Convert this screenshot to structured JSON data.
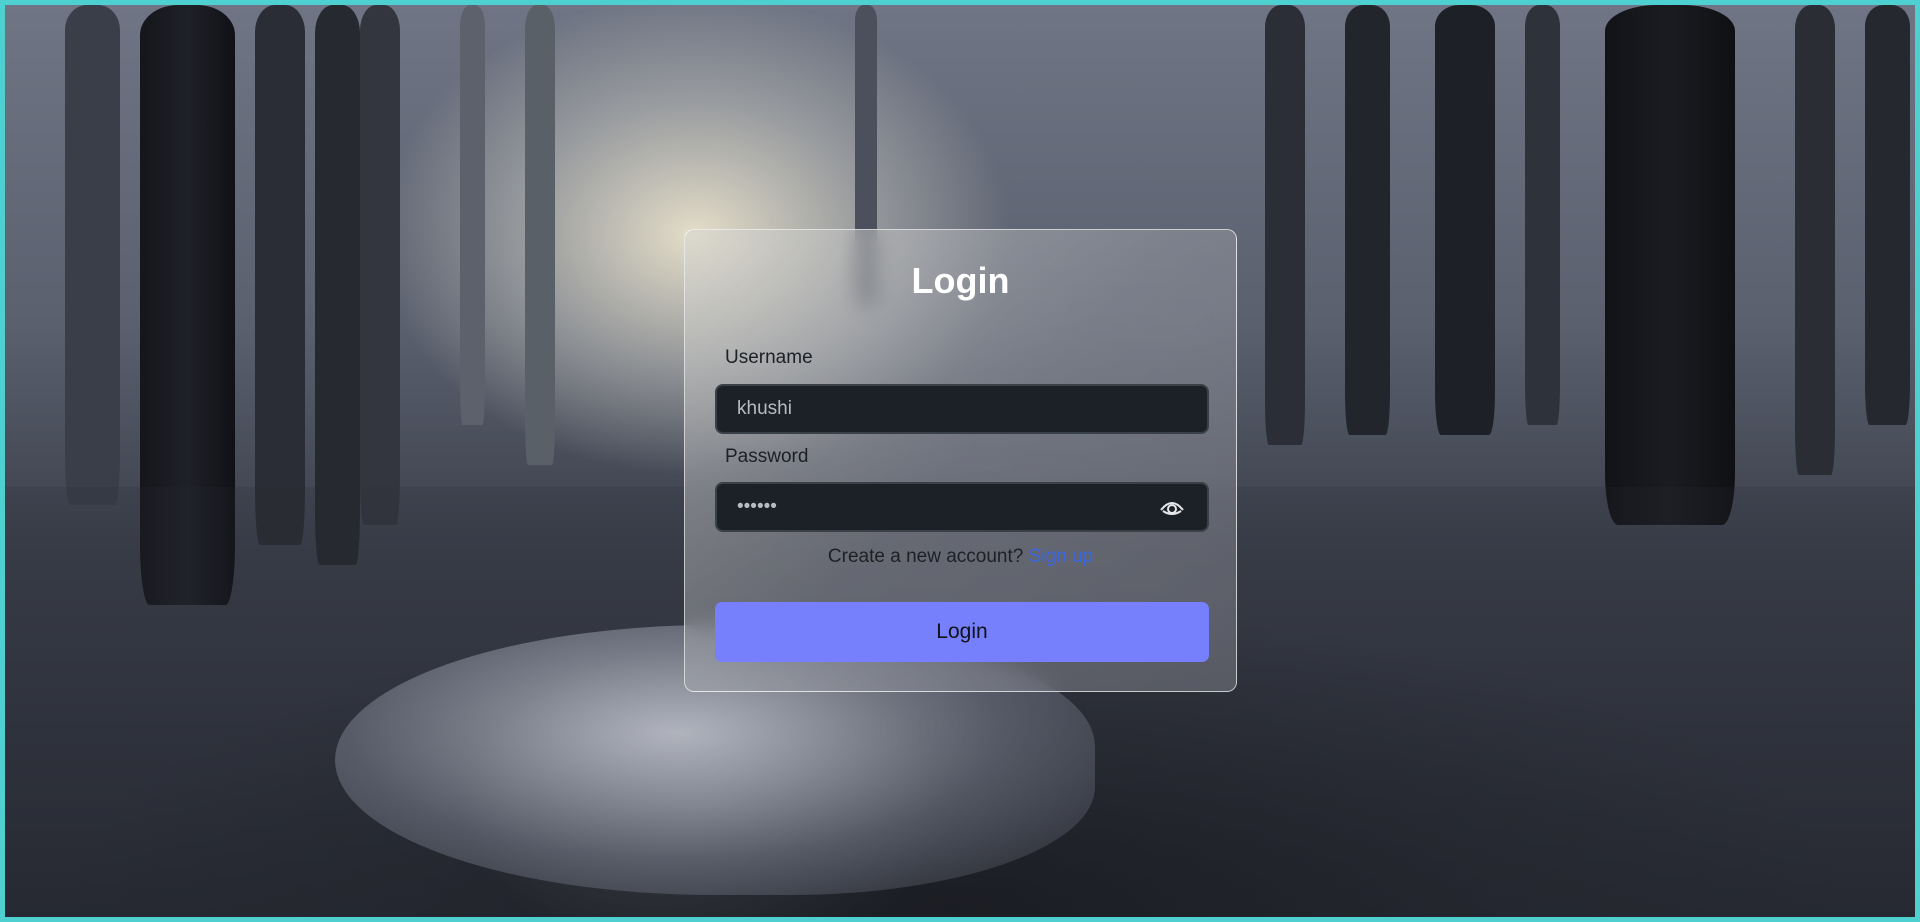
{
  "login_form": {
    "title": "Login",
    "username_label": "Username",
    "username_value": "khushi",
    "password_label": "Password",
    "password_value": "••••••",
    "password_toggle_icon": "eye-icon",
    "signup_prompt": "Create a new account?",
    "signup_link": "Sign up",
    "submit_label": "Login"
  },
  "colors": {
    "frame_border": "#4ecfd0",
    "input_background": "#1c2127",
    "button_background": "#7680fc",
    "link": "#3a67e0"
  }
}
